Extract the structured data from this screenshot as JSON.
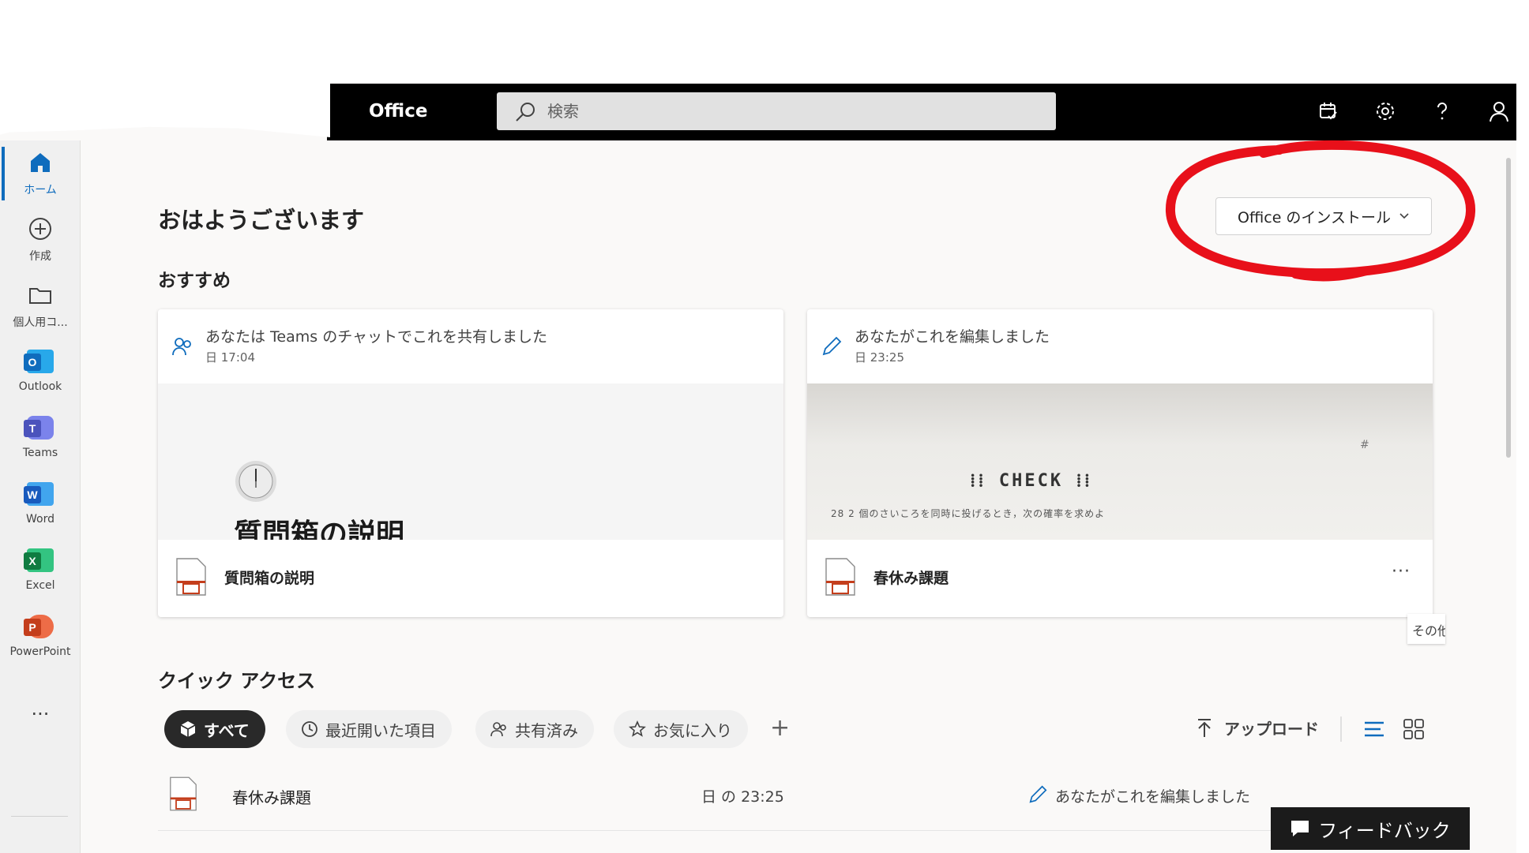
{
  "header": {
    "app_title": "Office",
    "search_placeholder": "検索"
  },
  "rail": {
    "items": [
      {
        "label": "ホーム",
        "icon": "home-icon",
        "active": true
      },
      {
        "label": "作成",
        "icon": "create-icon"
      },
      {
        "label": "個人用コ...",
        "icon": "folder-icon"
      },
      {
        "label": "Outlook",
        "icon": "outlook-icon",
        "letter": "O",
        "color": "#0f6cbd"
      },
      {
        "label": "Teams",
        "icon": "teams-icon",
        "letter": "T",
        "color": "#5b5fc7"
      },
      {
        "label": "Word",
        "icon": "word-icon",
        "letter": "W",
        "color": "#185abd"
      },
      {
        "label": "Excel",
        "icon": "excel-icon",
        "letter": "X",
        "color": "#107c41"
      },
      {
        "label": "PowerPoint",
        "icon": "powerpoint-icon",
        "letter": "P",
        "color": "#c43e1c"
      }
    ],
    "more": "..."
  },
  "main": {
    "greeting": "おはようございます",
    "install_button": "Office のインストール",
    "recommended_title": "おすすめ",
    "cards": [
      {
        "activity": "あなたは Teams のチャットでこれを共有しました",
        "time": "日 17:04",
        "thumb_title": "質問箱の説明",
        "file_name": "質問箱の説明"
      },
      {
        "activity": "あなたがこれを編集しました",
        "time": "日 23:25",
        "thumb_text": "CHECK",
        "thumb_line": "28 2 個のさいころを同時に投げるとき，次の確率を求めよ",
        "file_name": "春休み課題",
        "more": "···"
      }
    ],
    "tooltip": "その他"
  },
  "quick_access": {
    "title": "クイック アクセス",
    "filters": [
      {
        "label": "すべて",
        "icon": "cube-icon",
        "active": true
      },
      {
        "label": "最近開いた項目",
        "icon": "clock-icon"
      },
      {
        "label": "共有済み",
        "icon": "people-icon"
      },
      {
        "label": "お気に入り",
        "icon": "star-icon"
      }
    ],
    "add": "+",
    "upload": "アップロード",
    "files": [
      {
        "name": "春休み課題",
        "date": "日 の 23:25",
        "activity": "あなたがこれを編集しました"
      }
    ]
  },
  "feedback": "フィードバック",
  "colors": {
    "accent": "#0f6cbd",
    "topbar": "#000000",
    "annotation_red": "#e8101a",
    "powerpoint": "#c43e1c"
  }
}
